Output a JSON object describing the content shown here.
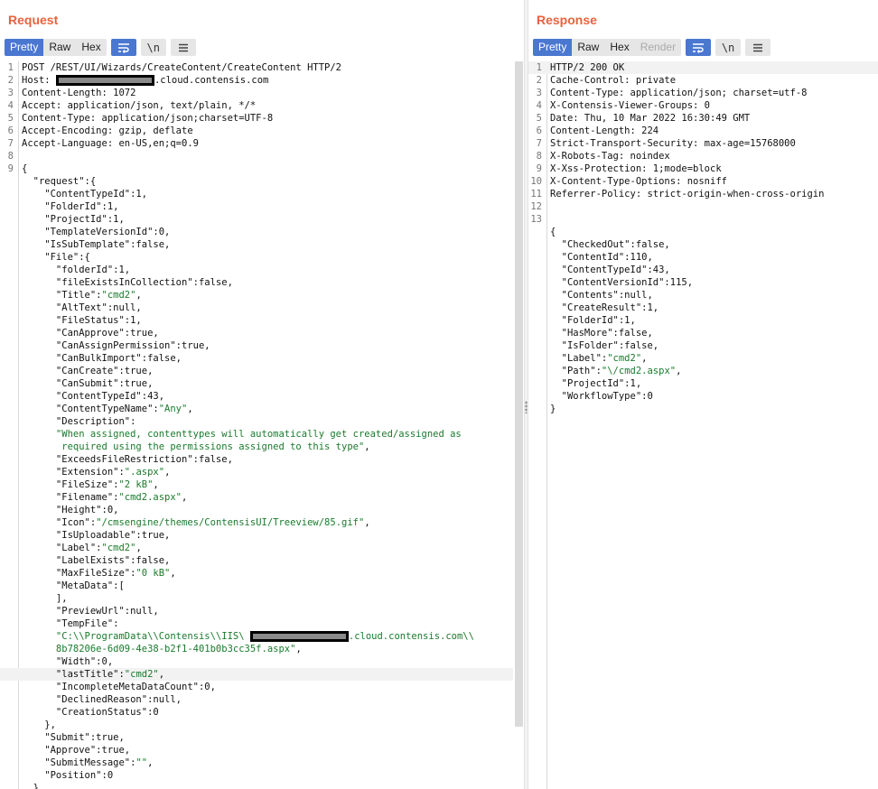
{
  "request": {
    "title": "Request",
    "tabs": [
      {
        "label": "Pretty",
        "active": true
      },
      {
        "label": "Raw"
      },
      {
        "label": "Hex"
      }
    ],
    "newline_label": "\\n",
    "lines": [
      {
        "n": "1",
        "parts": [
          {
            "t": "POST /REST/UI/Wizards/CreateContent/CreateContent HTTP/2"
          }
        ]
      },
      {
        "n": "2",
        "parts": [
          {
            "t": "Host: "
          },
          {
            "redact": true,
            "w": 107
          },
          {
            "t": ".cloud.contensis.com"
          }
        ]
      },
      {
        "n": "3",
        "parts": [
          {
            "t": "Content-Length: 1072"
          }
        ]
      },
      {
        "n": "4",
        "parts": [
          {
            "t": "Accept: application/json, text/plain, */*"
          }
        ]
      },
      {
        "n": "5",
        "parts": [
          {
            "t": "Content-Type: application/json;charset=UTF-8"
          }
        ]
      },
      {
        "n": "6",
        "parts": [
          {
            "t": "Accept-Encoding: gzip, deflate"
          }
        ]
      },
      {
        "n": "7",
        "parts": [
          {
            "t": "Accept-Language: en-US,en;q=0.9"
          }
        ]
      },
      {
        "n": "8",
        "parts": []
      },
      {
        "n": "9",
        "parts": [
          {
            "t": "{"
          }
        ]
      },
      {
        "n": "",
        "parts": [
          {
            "t": "  \"request\":{"
          }
        ]
      },
      {
        "n": "",
        "parts": [
          {
            "t": "    \"ContentTypeId\":1,"
          }
        ]
      },
      {
        "n": "",
        "parts": [
          {
            "t": "    \"FolderId\":1,"
          }
        ]
      },
      {
        "n": "",
        "parts": [
          {
            "t": "    \"ProjectId\":1,"
          }
        ]
      },
      {
        "n": "",
        "parts": [
          {
            "t": "    \"TemplateVersionId\":0,"
          }
        ]
      },
      {
        "n": "",
        "parts": [
          {
            "t": "    \"IsSubTemplate\":false,"
          }
        ]
      },
      {
        "n": "",
        "parts": [
          {
            "t": "    \"File\":{"
          }
        ]
      },
      {
        "n": "",
        "parts": [
          {
            "t": "      \"folderId\":1,"
          }
        ]
      },
      {
        "n": "",
        "parts": [
          {
            "t": "      \"fileExistsInCollection\":false,"
          }
        ]
      },
      {
        "n": "",
        "parts": [
          {
            "t": "      \"Title\":"
          },
          {
            "t": "\"cmd2\"",
            "c": "str"
          },
          {
            "t": ","
          }
        ]
      },
      {
        "n": "",
        "parts": [
          {
            "t": "      \"AltText\":null,"
          }
        ]
      },
      {
        "n": "",
        "parts": [
          {
            "t": "      \"FileStatus\":1,"
          }
        ]
      },
      {
        "n": "",
        "parts": [
          {
            "t": "      \"CanApprove\":true,"
          }
        ]
      },
      {
        "n": "",
        "parts": [
          {
            "t": "      \"CanAssignPermission\":true,"
          }
        ]
      },
      {
        "n": "",
        "parts": [
          {
            "t": "      \"CanBulkImport\":false,"
          }
        ]
      },
      {
        "n": "",
        "parts": [
          {
            "t": "      \"CanCreate\":true,"
          }
        ]
      },
      {
        "n": "",
        "parts": [
          {
            "t": "      \"CanSubmit\":true,"
          }
        ]
      },
      {
        "n": "",
        "parts": [
          {
            "t": "      \"ContentTypeId\":43,"
          }
        ]
      },
      {
        "n": "",
        "parts": [
          {
            "t": "      \"ContentTypeName\":"
          },
          {
            "t": "\"Any\"",
            "c": "str"
          },
          {
            "t": ","
          }
        ]
      },
      {
        "n": "",
        "parts": [
          {
            "t": "      \"Description\":"
          }
        ]
      },
      {
        "n": "",
        "parts": [
          {
            "t": "      \"When assigned, contenttypes will automatically get created/assigned as",
            "c": "str"
          }
        ]
      },
      {
        "n": "",
        "parts": [
          {
            "t": "       required using the permissions assigned to this type\"",
            "c": "str"
          },
          {
            "t": ","
          }
        ]
      },
      {
        "n": "",
        "parts": [
          {
            "t": "      \"ExceedsFileRestriction\":false,"
          }
        ]
      },
      {
        "n": "",
        "parts": [
          {
            "t": "      \"Extension\":"
          },
          {
            "t": "\".aspx\"",
            "c": "str"
          },
          {
            "t": ","
          }
        ]
      },
      {
        "n": "",
        "parts": [
          {
            "t": "      \"FileSize\":"
          },
          {
            "t": "\"2 kB\"",
            "c": "str"
          },
          {
            "t": ","
          }
        ]
      },
      {
        "n": "",
        "parts": [
          {
            "t": "      \"Filename\":"
          },
          {
            "t": "\"cmd2.aspx\"",
            "c": "str"
          },
          {
            "t": ","
          }
        ]
      },
      {
        "n": "",
        "parts": [
          {
            "t": "      \"Height\":0,"
          }
        ]
      },
      {
        "n": "",
        "parts": [
          {
            "t": "      \"Icon\":"
          },
          {
            "t": "\"/cmsengine/themes/ContensisUI/Treeview/85.gif\"",
            "c": "str"
          },
          {
            "t": ","
          }
        ]
      },
      {
        "n": "",
        "parts": [
          {
            "t": "      \"IsUploadable\":true,"
          }
        ]
      },
      {
        "n": "",
        "parts": [
          {
            "t": "      \"Label\":"
          },
          {
            "t": "\"cmd2\"",
            "c": "str"
          },
          {
            "t": ","
          }
        ]
      },
      {
        "n": "",
        "parts": [
          {
            "t": "      \"LabelExists\":false,"
          }
        ]
      },
      {
        "n": "",
        "parts": [
          {
            "t": "      \"MaxFileSize\":"
          },
          {
            "t": "\"0 kB\"",
            "c": "str"
          },
          {
            "t": ","
          }
        ]
      },
      {
        "n": "",
        "parts": [
          {
            "t": "      \"MetaData\":["
          }
        ]
      },
      {
        "n": "",
        "parts": [
          {
            "t": "      ],"
          }
        ]
      },
      {
        "n": "",
        "parts": [
          {
            "t": "      \"PreviewUrl\":null,"
          }
        ]
      },
      {
        "n": "",
        "parts": [
          {
            "t": "      \"TempFile\":"
          }
        ]
      },
      {
        "n": "",
        "parts": [
          {
            "t": "      \"C:\\\\ProgramData\\\\Contensis\\\\IIS\\ ",
            "c": "str"
          },
          {
            "redact": true,
            "w": 107
          },
          {
            "t": ".cloud.contensis.com\\\\",
            "c": "str"
          }
        ]
      },
      {
        "n": "",
        "parts": [
          {
            "t": "      8b78206e-6d09-4e38-b2f1-401b0b3cc35f.aspx\"",
            "c": "str"
          },
          {
            "t": ","
          }
        ]
      },
      {
        "n": "",
        "parts": [
          {
            "t": "      \"Width\":0,"
          }
        ]
      },
      {
        "n": "",
        "hl": true,
        "parts": [
          {
            "t": "      \"lastTitle\":"
          },
          {
            "t": "\"cmd2\"",
            "c": "str"
          },
          {
            "t": ","
          }
        ]
      },
      {
        "n": "",
        "parts": [
          {
            "t": "      \"IncompleteMetaDataCount\":0,"
          }
        ]
      },
      {
        "n": "",
        "parts": [
          {
            "t": "      \"DeclinedReason\":null,"
          }
        ]
      },
      {
        "n": "",
        "parts": [
          {
            "t": "      \"CreationStatus\":0"
          }
        ]
      },
      {
        "n": "",
        "parts": [
          {
            "t": "    },"
          }
        ]
      },
      {
        "n": "",
        "parts": [
          {
            "t": "    \"Submit\":true,"
          }
        ]
      },
      {
        "n": "",
        "parts": [
          {
            "t": "    \"Approve\":true,"
          }
        ]
      },
      {
        "n": "",
        "parts": [
          {
            "t": "    \"SubmitMessage\":"
          },
          {
            "t": "\"\"",
            "c": "str"
          },
          {
            "t": ","
          }
        ]
      },
      {
        "n": "",
        "parts": [
          {
            "t": "    \"Position\":0"
          }
        ]
      },
      {
        "n": "",
        "parts": [
          {
            "t": "  }"
          }
        ]
      }
    ]
  },
  "response": {
    "title": "Response",
    "tabs": [
      {
        "label": "Pretty",
        "active": true
      },
      {
        "label": "Raw"
      },
      {
        "label": "Hex"
      },
      {
        "label": "Render",
        "disabled": true
      }
    ],
    "newline_label": "\\n",
    "lines": [
      {
        "n": "1",
        "hl": true,
        "parts": [
          {
            "t": "HTTP/2 200 OK"
          }
        ]
      },
      {
        "n": "2",
        "parts": [
          {
            "t": "Cache-Control: private"
          }
        ]
      },
      {
        "n": "3",
        "parts": [
          {
            "t": "Content-Type: application/json; charset=utf-8"
          }
        ]
      },
      {
        "n": "4",
        "parts": [
          {
            "t": "X-Contensis-Viewer-Groups: 0"
          }
        ]
      },
      {
        "n": "5",
        "parts": [
          {
            "t": "Date: Thu, 10 Mar 2022 16:30:49 GMT"
          }
        ]
      },
      {
        "n": "6",
        "parts": [
          {
            "t": "Content-Length: 224"
          }
        ]
      },
      {
        "n": "7",
        "parts": [
          {
            "t": "Strict-Transport-Security: max-age=15768000"
          }
        ]
      },
      {
        "n": "8",
        "parts": [
          {
            "t": "X-Robots-Tag: noindex"
          }
        ]
      },
      {
        "n": "9",
        "parts": [
          {
            "t": "X-Xss-Protection: 1;mode=block"
          }
        ]
      },
      {
        "n": "10",
        "parts": [
          {
            "t": "X-Content-Type-Options: nosniff"
          }
        ]
      },
      {
        "n": "11",
        "parts": [
          {
            "t": "Referrer-Policy: strict-origin-when-cross-origin"
          }
        ]
      },
      {
        "n": "12",
        "parts": []
      },
      {
        "n": "13",
        "parts": []
      },
      {
        "n": "",
        "parts": [
          {
            "t": "{"
          }
        ]
      },
      {
        "n": "",
        "parts": [
          {
            "t": "  \"CheckedOut\":false,"
          }
        ]
      },
      {
        "n": "",
        "parts": [
          {
            "t": "  \"ContentId\":110,"
          }
        ]
      },
      {
        "n": "",
        "parts": [
          {
            "t": "  \"ContentTypeId\":43,"
          }
        ]
      },
      {
        "n": "",
        "parts": [
          {
            "t": "  \"ContentVersionId\":115,"
          }
        ]
      },
      {
        "n": "",
        "parts": [
          {
            "t": "  \"Contents\":null,"
          }
        ]
      },
      {
        "n": "",
        "parts": [
          {
            "t": "  \"CreateResult\":1,"
          }
        ]
      },
      {
        "n": "",
        "parts": [
          {
            "t": "  \"FolderId\":1,"
          }
        ]
      },
      {
        "n": "",
        "parts": [
          {
            "t": "  \"HasMore\":false,"
          }
        ]
      },
      {
        "n": "",
        "parts": [
          {
            "t": "  \"IsFolder\":false,"
          }
        ]
      },
      {
        "n": "",
        "parts": [
          {
            "t": "  \"Label\":"
          },
          {
            "t": "\"cmd2\"",
            "c": "str"
          },
          {
            "t": ","
          }
        ]
      },
      {
        "n": "",
        "parts": [
          {
            "t": "  \"Path\":"
          },
          {
            "t": "\"\\/cmd2.aspx\"",
            "c": "str"
          },
          {
            "t": ","
          }
        ]
      },
      {
        "n": "",
        "parts": [
          {
            "t": "  \"ProjectId\":1,"
          }
        ]
      },
      {
        "n": "",
        "parts": [
          {
            "t": "  \"WorkflowType\":0"
          }
        ]
      },
      {
        "n": "",
        "parts": [
          {
            "t": "}"
          }
        ]
      }
    ]
  },
  "colors": {
    "accent": "#e8623d",
    "tab_active": "#4a77d0",
    "string": "#1a7a2c"
  },
  "icons": [
    "wrap-lines-icon",
    "newline-icon",
    "menu-icon"
  ]
}
